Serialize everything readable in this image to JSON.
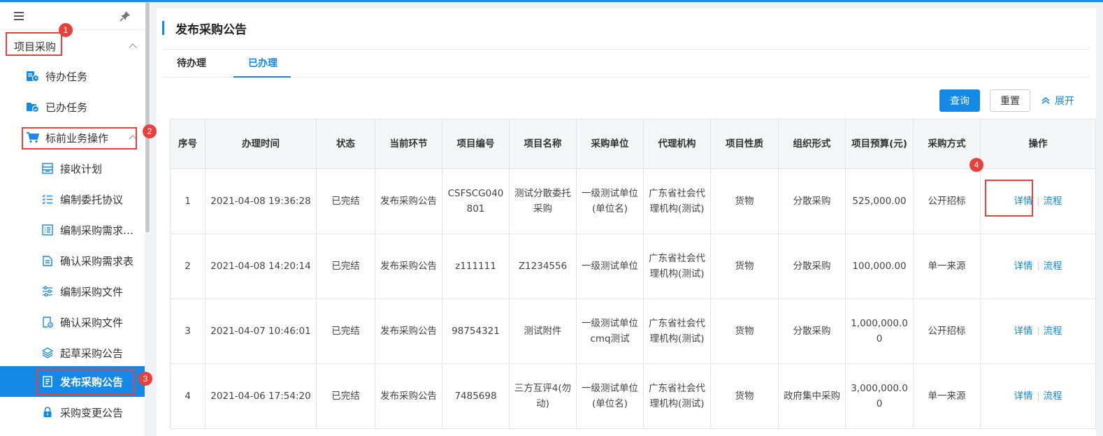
{
  "sidebar": {
    "section": "项目采购",
    "items": [
      {
        "label": "待办任务"
      },
      {
        "label": "已办任务"
      },
      {
        "label": "标前业务操作"
      },
      {
        "label": "接收计划"
      },
      {
        "label": "编制委托协议"
      },
      {
        "label": "编制采购需求…"
      },
      {
        "label": "确认采购需求表"
      },
      {
        "label": "编制采购文件"
      },
      {
        "label": "确认采购文件"
      },
      {
        "label": "起草采购公告"
      },
      {
        "label": "发布采购公告"
      },
      {
        "label": "采购变更公告"
      }
    ]
  },
  "badges": [
    "1",
    "2",
    "3",
    "4"
  ],
  "main": {
    "title": "发布采购公告",
    "tabs": [
      {
        "label": "待办理"
      },
      {
        "label": "已办理"
      }
    ],
    "buttons": {
      "query": "查询",
      "reset": "重置",
      "expand": "展开"
    }
  },
  "table": {
    "headers": [
      "序号",
      "办理时间",
      "状态",
      "当前环节",
      "项目编号",
      "项目名称",
      "采购单位",
      "代理机构",
      "项目性质",
      "组织形式",
      "项目预算(元)",
      "采购方式",
      "操作"
    ],
    "rows": [
      {
        "no": "1",
        "time": "2021-04-08 19:36:28",
        "status": "已完结",
        "stage": "发布采购公告",
        "code": "CSFSCG040801",
        "name": "测试分散委托采购",
        "unit": "一级测试单位(单位名)",
        "agency": "广东省社会代理机构(测试)",
        "nature": "货物",
        "form": "分散采购",
        "budget": "525,000.00",
        "method": "公开招标",
        "detail": "详情",
        "flow": "流程"
      },
      {
        "no": "2",
        "time": "2021-04-08 14:20:14",
        "status": "已完结",
        "stage": "发布采购公告",
        "code": "z111111",
        "name": "Z1234556",
        "unit": "一级测试单位",
        "agency": "广东省社会代理机构(测试)",
        "nature": "货物",
        "form": "分散采购",
        "budget": "100,000.00",
        "method": "单一来源",
        "detail": "详情",
        "flow": "流程"
      },
      {
        "no": "3",
        "time": "2021-04-07 10:46:01",
        "status": "已完结",
        "stage": "发布采购公告",
        "code": "98754321",
        "name": "测试附件",
        "unit": "一级测试单位cmq测试",
        "agency": "广东省社会代理机构(测试)",
        "nature": "货物",
        "form": "分散采购",
        "budget": "1,000,000.00",
        "method": "公开招标",
        "detail": "详情",
        "flow": "流程"
      },
      {
        "no": "4",
        "time": "2021-04-06 17:54:20",
        "status": "已完结",
        "stage": "发布采购公告",
        "code": "7485698",
        "name": "三方互评4(勿动)",
        "unit": "一级测试单位(单位名)",
        "agency": "广东省社会代理机构(测试)",
        "nature": "货物",
        "form": "政府集中采购",
        "budget": "3,000,000.00",
        "method": "单一来源",
        "detail": "详情",
        "flow": "流程"
      }
    ]
  },
  "colors": {
    "accent": "#1589e6",
    "annotation": "#e8413c"
  }
}
